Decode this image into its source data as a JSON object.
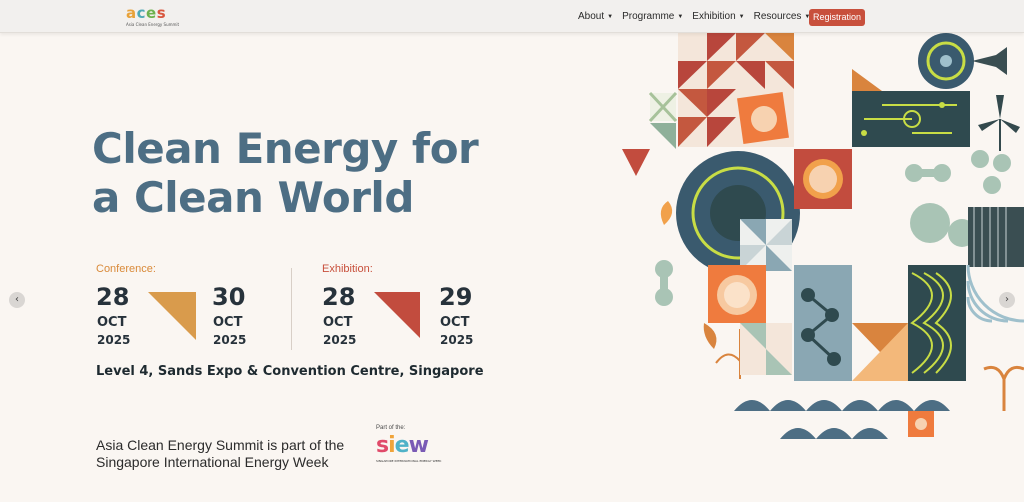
{
  "header": {
    "logo_text": [
      "a",
      "c",
      "e",
      "s"
    ],
    "logo_subtitle": "Asia Clean Energy Summit",
    "nav": [
      {
        "label": "About"
      },
      {
        "label": "Programme"
      },
      {
        "label": "Exhibition"
      },
      {
        "label": "Resources"
      }
    ],
    "registration_label": "Registration"
  },
  "hero": {
    "headline_line1": "Clean Energy for",
    "headline_line2": "a Clean World",
    "conference": {
      "label": "Conference:",
      "start_day": "28",
      "start_month": "OCT",
      "start_year": "2025",
      "end_day": "30",
      "end_month": "OCT",
      "end_year": "2025"
    },
    "exhibition": {
      "label": "Exhibition:",
      "start_day": "28",
      "start_month": "OCT",
      "start_year": "2025",
      "end_day": "29",
      "end_month": "OCT",
      "end_year": "2025"
    },
    "venue": "Level 4, Sands Expo & Convention Centre, Singapore",
    "summit_line1": "Asia Clean Energy Summit is part of the",
    "summit_line2": "Singapore International Energy Week",
    "part_of": "Part of the:",
    "siew_text": [
      "s",
      "i",
      "e",
      "w"
    ],
    "siew_subtitle": "SINGAPORE INTERNATIONAL ENERGY WEEK"
  },
  "carousel": {
    "prev_icon": "chevron-left-icon",
    "next_icon": "chevron-right-icon",
    "prev_glyph": "‹",
    "next_glyph": "›"
  },
  "colors": {
    "brand_blue": "#4d6e84",
    "registration": "#c8503c",
    "conference_label": "#d98a3a",
    "exhibition_label": "#c8503c"
  }
}
